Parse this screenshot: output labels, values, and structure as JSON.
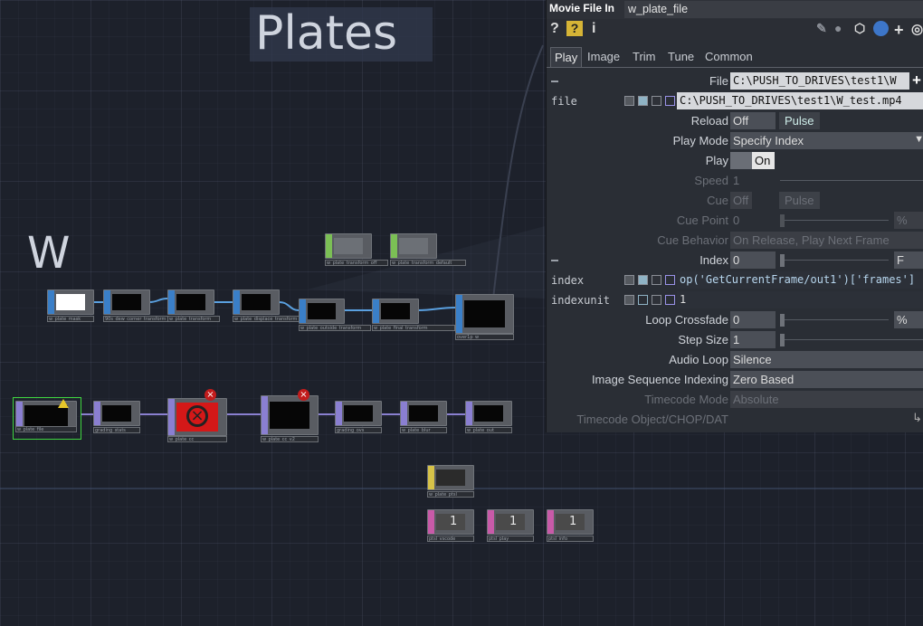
{
  "network": {
    "title_plates": "Plates",
    "title_w": "W",
    "nodes": [
      {
        "label": "w_plate_mask"
      },
      {
        "label": "90s_dew_corner_transform"
      },
      {
        "label": "w_plate_transform"
      },
      {
        "label": "w_plate_displace_transform"
      },
      {
        "label": "w_plate_outside_transform"
      },
      {
        "label": "w_plate_final_transform"
      },
      {
        "label": "over1p_w"
      },
      {
        "label": "w_plate_transform_off"
      },
      {
        "label": "w_plate_transform_default"
      },
      {
        "label": "w_plate_file"
      },
      {
        "label": "grading_stats"
      },
      {
        "label": "w_plate_cc"
      },
      {
        "label": "w_plate_cc_v2"
      },
      {
        "label": "grading_ovs"
      },
      {
        "label": "w_plate_blur"
      },
      {
        "label": "w_plate_out"
      },
      {
        "label": "w_plate_ptsl"
      },
      {
        "label": "ptsl_vscode"
      },
      {
        "label": "ptsl_play"
      },
      {
        "label": "ptsl_info"
      }
    ],
    "chop_values": [
      "1",
      "1",
      "1"
    ],
    "error_glyph": "×"
  },
  "panel": {
    "op_type": "Movie File In",
    "op_name": "w_plate_file",
    "toolbar": {
      "help_icon": "question-icon",
      "python_help_icon": "python-help-icon",
      "info_icon": "info-icon",
      "right_icons": [
        "edit-icon",
        "comment-icon",
        "clone-icon",
        "python-icon",
        "add-icon",
        "target-icon"
      ]
    },
    "tabs": [
      "Play",
      "Image",
      "Trim",
      "Tune",
      "Common"
    ],
    "active_tab": "Play",
    "params": {
      "file_label": "File",
      "file_value": "C:\\PUSH_TO_DRIVES\\test1\\W",
      "file_expr_label": "file",
      "file_expr_value": "C:\\PUSH_TO_DRIVES\\test1\\W_test.mp4",
      "reload_label": "Reload",
      "reload_value": "Off",
      "reload_pulse": "Pulse",
      "play_mode_label": "Play Mode",
      "play_mode_value": "Specify Index",
      "play_label": "Play",
      "play_value": "On",
      "speed_label": "Speed",
      "speed_value": "1",
      "cue_label": "Cue",
      "cue_value": "Off",
      "cue_pulse": "Pulse",
      "cue_point_label": "Cue Point",
      "cue_point_value": "0",
      "cue_point_unit": "%",
      "cue_behavior_label": "Cue Behavior",
      "cue_behavior_value": "On Release, Play Next Frame",
      "index_label": "Index",
      "index_value": "0",
      "index_unit": "F",
      "index_expr_label": "index",
      "index_expr_value": "op('GetCurrentFrame/out1')['frames']",
      "indexunit_label": "indexunit",
      "indexunit_value": "1",
      "loop_crossfade_label": "Loop Crossfade",
      "loop_crossfade_value": "0",
      "loop_crossfade_unit": "%",
      "step_size_label": "Step Size",
      "step_size_value": "1",
      "audio_loop_label": "Audio Loop",
      "audio_loop_value": "Silence",
      "image_seq_label": "Image Sequence Indexing",
      "image_seq_value": "Zero Based",
      "timecode_mode_label": "Timecode Mode",
      "timecode_mode_value": "Absolute",
      "timecode_obj_label": "Timecode Object/CHOP/DAT"
    }
  }
}
